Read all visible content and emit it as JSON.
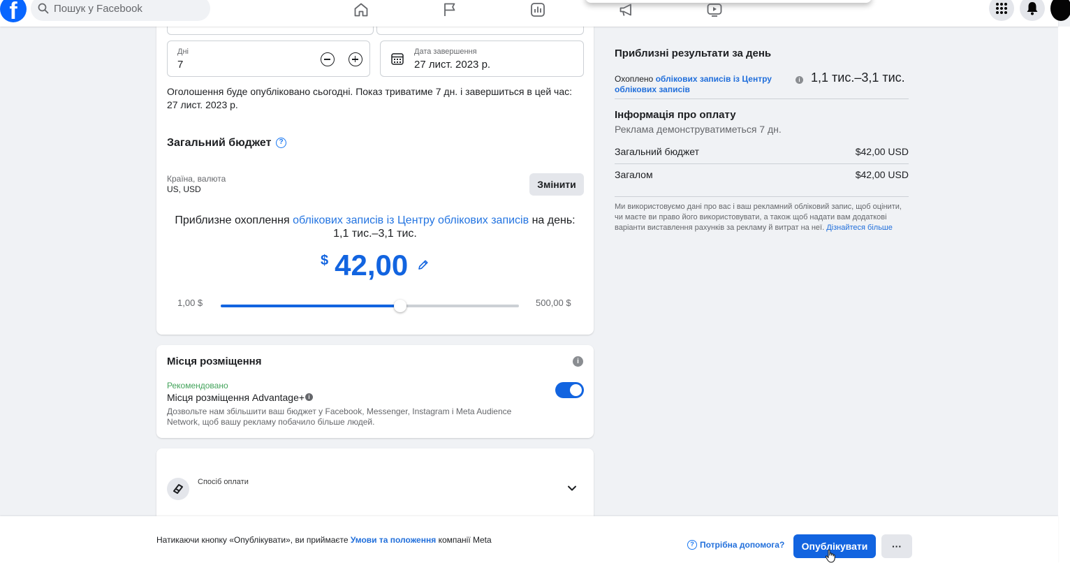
{
  "topbar": {
    "logo_letter": "f",
    "search_placeholder": "Пошук у Facebook",
    "nav_icons": [
      "home-icon",
      "flag-icon",
      "chart-icon",
      "megaphone-icon",
      "video-icon"
    ]
  },
  "duration": {
    "days_label": "Дні",
    "days_value": "7",
    "end_date_label": "Дата завершення",
    "end_date_value": "27 лист. 2023 р.",
    "notice": "Оголошення буде опубліковано сьогодні. Показ триватиме 7 дн. і завершиться в цей час: 27 лист. 2023 р."
  },
  "budget": {
    "title": "Загальний бюджет",
    "country_label": "Країна, валюта",
    "country_value": "US, USD",
    "change_button": "Змінити",
    "reach_prefix": "Приблизне охоплення",
    "reach_link": "облікових записів із Центру облікових записів",
    "reach_suffix": "на день:",
    "reach_range": "1,1 тис.–3,1 тис.",
    "currency_symbol": "$",
    "amount": "42,00",
    "slider_min": "1,00 $",
    "slider_max": "500,00 $",
    "slider_min_value": 1,
    "slider_max_value": 500,
    "slider_value": 42
  },
  "placements": {
    "title": "Місця розміщення",
    "recommended": "Рекомендовано",
    "option_label": "Місця розміщення Advantage+",
    "description": "Дозвольте нам збільшити ваш бюджет у Facebook, Messenger, Instagram і Meta Audience Network, щоб вашу рекламу побачило більше людей.",
    "enabled": true
  },
  "payment": {
    "label": "Спосіб оплати"
  },
  "summary": {
    "title": "Приблизні результати за день",
    "reach_prefix": "Охоплено",
    "reach_link": "облікових записів із Центру облікових записів",
    "reach_value": "1,1 тис.–3,1 тис.",
    "payment_title": "Інформація про оплату",
    "payment_subtitle": "Реклама демонструватиметься 7 дн.",
    "total_budget_label": "Загальний бюджет",
    "total_budget_value": "$42,00 USD",
    "total_label": "Загалом",
    "total_value": "$42,00 USD",
    "disclaimer": "Ми використовуємо дані про вас і ваш рекламний обліковий запис, щоб оцінити, чи маєте ви право його використовувати, а також щоб надати вам додаткові варіанти виставлення рахунків за рекламу й витрат на неї.",
    "learn_more": "Дізнайтеся більше"
  },
  "footer": {
    "terms_prefix": "Натикаючи кнопку «Опублікувати», ви приймаєте",
    "terms_link": "Умови та положення",
    "terms_suffix": "компанії Meta",
    "help": "Потрібна допомога?",
    "publish": "Опублікувати",
    "more": "···"
  },
  "colors": {
    "accent": "#1264e0",
    "link": "#385898",
    "recommended": "#42a35a"
  }
}
